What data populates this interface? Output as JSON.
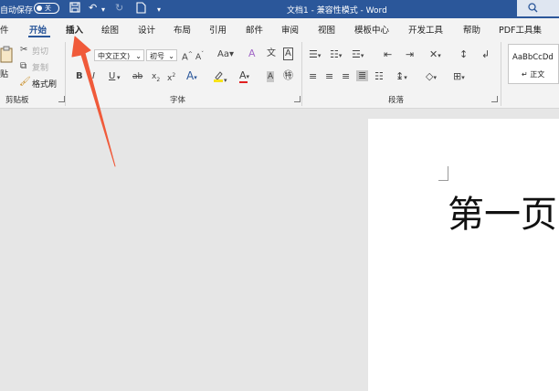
{
  "titlebar": {
    "autosave_label": "自动保存",
    "autosave_toggle": "关",
    "doc_title": "文档1 - 兼容性模式 - Word",
    "search_icon": "search-icon"
  },
  "tabs": [
    "件",
    "开始",
    "插入",
    "绘图",
    "设计",
    "布局",
    "引用",
    "邮件",
    "审阅",
    "视图",
    "模板中心",
    "开发工具",
    "帮助",
    "PDF工具集"
  ],
  "ribbon": {
    "clipboard": {
      "paste": "贴",
      "cut": "剪切",
      "copy": "复制",
      "format_painter": "格式刷",
      "group_label": "剪贴板"
    },
    "font": {
      "font_name": "中文正文)",
      "font_size": "初号",
      "group_label": "字体"
    },
    "paragraph": {
      "group_label": "段落"
    },
    "styles": {
      "preview": "AaBbCcDd",
      "name": "↵ 正文"
    }
  },
  "document": {
    "heading": "第一页"
  },
  "colors": {
    "title_bar": "#2b579a",
    "ribbon_bg": "#f3f3f3",
    "workspace_bg": "#e6e6e6",
    "arrow": "#f05a3a"
  }
}
